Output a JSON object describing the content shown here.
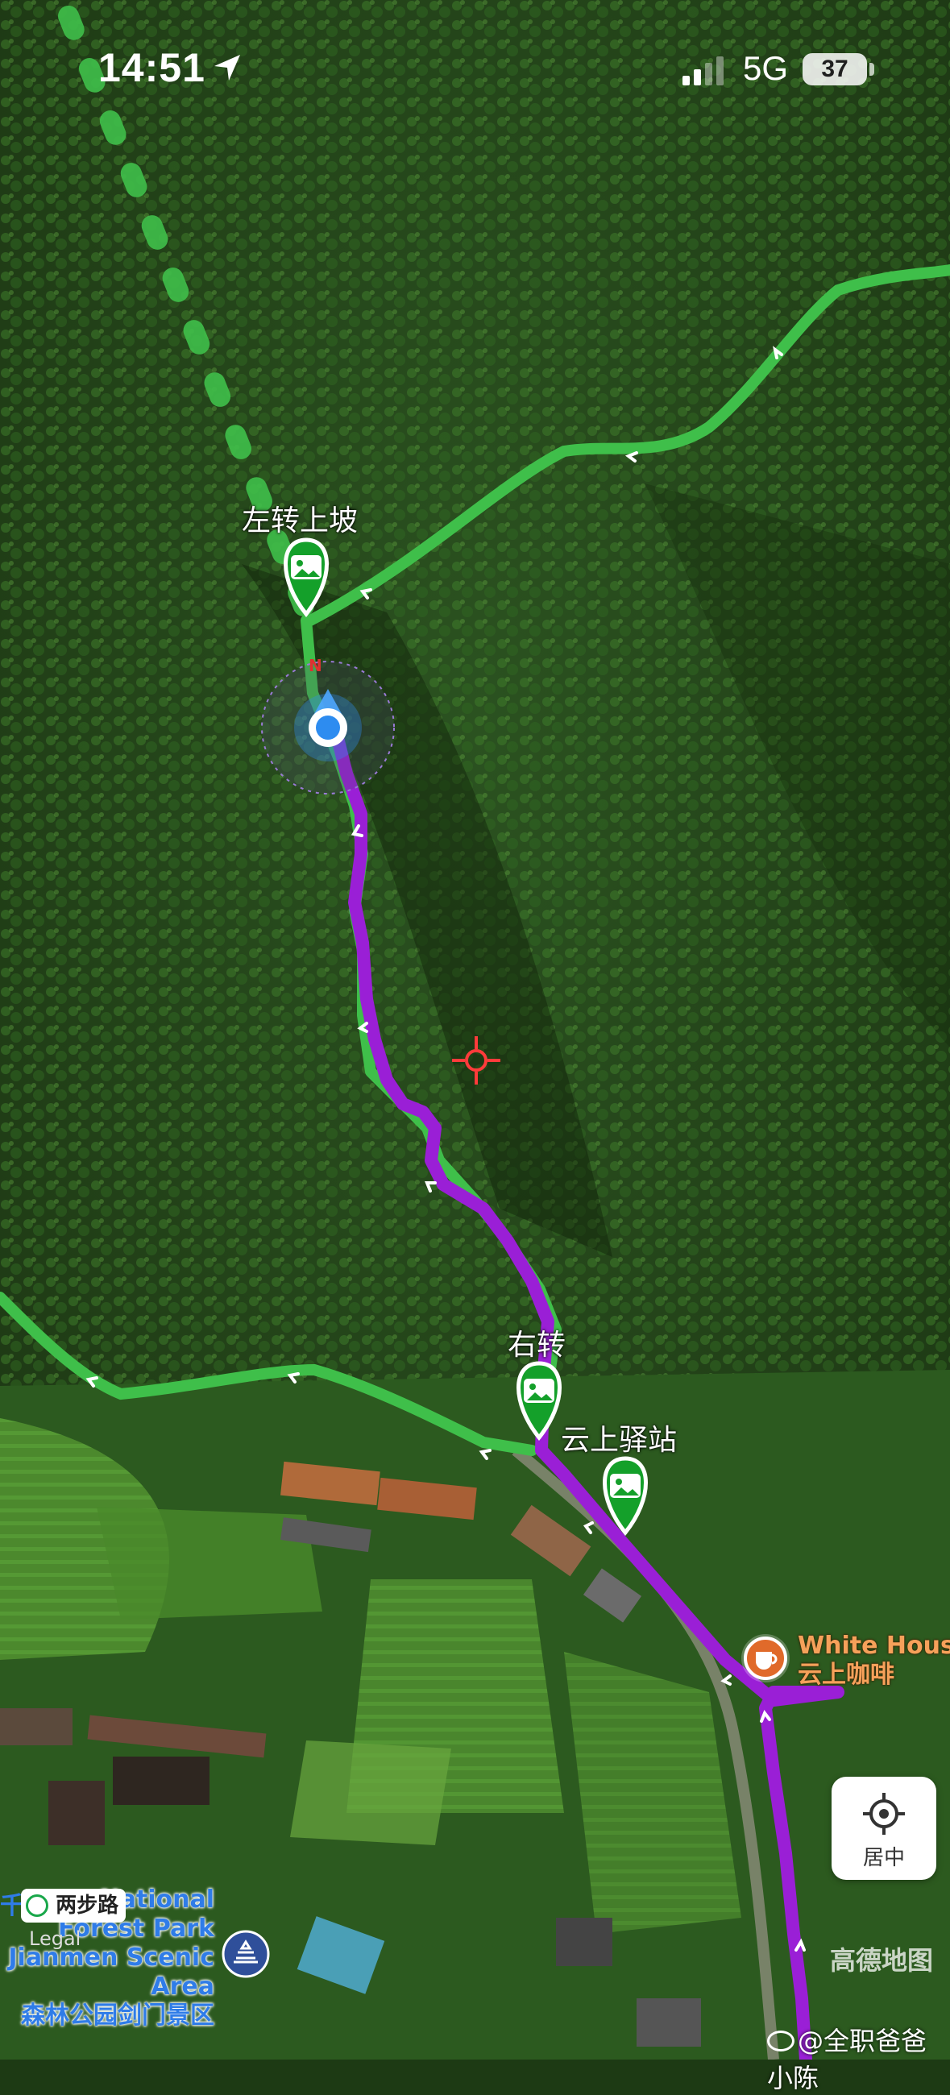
{
  "status_bar": {
    "time": "14:51",
    "network": "5G",
    "battery": "37"
  },
  "map": {
    "labels": {
      "left_turn_uphill": "左转上坡",
      "right_turn": "右转",
      "cloud_station": "云上驿站"
    },
    "poi": {
      "name_en": "White Hous",
      "name_cn": "云上咖啡",
      "icon": "coffee-icon"
    },
    "park_label": {
      "line1": "National",
      "line2": "Forest Park",
      "line3": "Jianmen Scenic",
      "line4": "Area",
      "line5": "森林公园剑门景区",
      "prefix": "千"
    },
    "route_badge": "两步路",
    "legal": "Legal",
    "amap_watermark": "高德地图",
    "compass_letter": "N"
  },
  "controls": {
    "center_button_label": "居中"
  },
  "watermark": {
    "weibo_text": "@全职爸爸小陈"
  },
  "colors": {
    "green_trail": "#3fbf4a",
    "purple_route": "#9a1fd6",
    "location_blue": "#2d8cf0",
    "poi_orange": "#f6a15a"
  }
}
